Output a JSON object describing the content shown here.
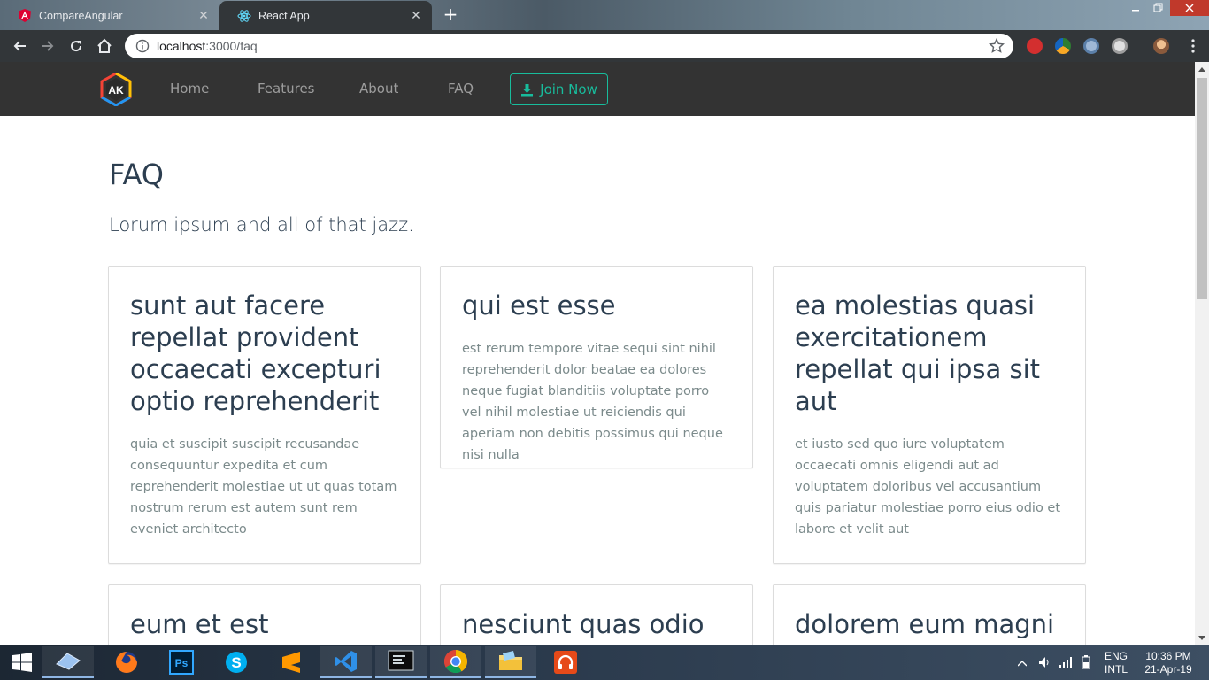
{
  "browser": {
    "tabs": [
      {
        "title": "CompareAngular",
        "icon": "angular-icon",
        "active": false
      },
      {
        "title": "React App",
        "icon": "react-icon",
        "active": true
      }
    ],
    "address": {
      "host": "localhost",
      "path": ":3000/faq"
    }
  },
  "navbar": {
    "brand_text": "AK",
    "links": [
      {
        "label": "Home"
      },
      {
        "label": "Features"
      },
      {
        "label": "About"
      },
      {
        "label": "FAQ"
      }
    ],
    "cta_label": "Join Now",
    "cta_color": "#18bc9c",
    "bg_color": "#333333"
  },
  "main": {
    "title": "FAQ",
    "lead": "Lorum ipsum and all of that jazz.",
    "cards": [
      {
        "title": "sunt aut facere repellat provident occaecati excepturi optio reprehenderit",
        "body": "quia et suscipit suscipit recusandae consequuntur expedita et cum reprehenderit molestiae ut ut quas totam nostrum rerum est autem sunt rem eveniet architecto"
      },
      {
        "title": "qui est esse",
        "body": "est rerum tempore vitae sequi sint nihil reprehenderit dolor beatae ea dolores neque fugiat blanditiis voluptate porro vel nihil molestiae ut reiciendis qui aperiam non debitis possimus qui neque nisi nulla"
      },
      {
        "title": "ea molestias quasi exercitationem repellat qui ipsa sit aut",
        "body": "et iusto sed quo iure voluptatem occaecati omnis eligendi aut ad voluptatem doloribus vel accusantium quis pariatur molestiae porro eius odio et labore et velit aut"
      },
      {
        "title": "eum et est occaecati",
        "body": ""
      },
      {
        "title": "nesciunt quas odio",
        "body": ""
      },
      {
        "title": "dolorem eum magni",
        "body": ""
      }
    ]
  },
  "taskbar": {
    "apps": [
      "task-view",
      "firefox",
      "photoshop",
      "skype",
      "sublime-text",
      "vscode",
      "terminal",
      "chrome",
      "file-explorer",
      "music"
    ],
    "lang_1": "ENG",
    "lang_2": "INTL",
    "time": "10:36 PM",
    "date": "21-Apr-19"
  }
}
